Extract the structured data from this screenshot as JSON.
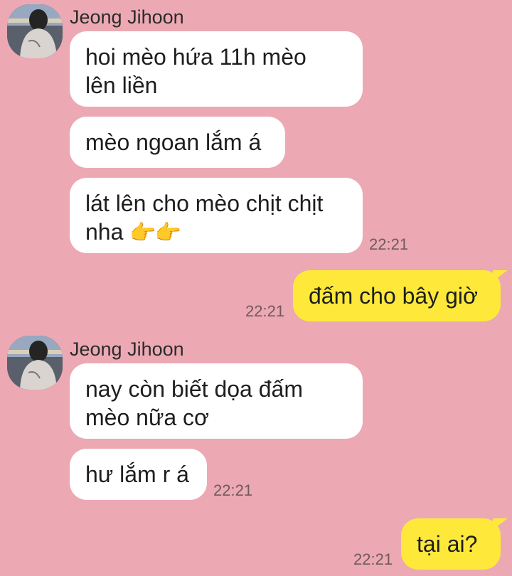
{
  "chat": {
    "groups": [
      {
        "sender": "Jeong Jihoon",
        "messages": [
          "hoi mèo hứa 11h mèo",
          "lên liền",
          "mèo ngoan lắm á",
          "lát lên cho mèo chịt chịt",
          "nha"
        ],
        "emoji": "👉👉",
        "time": "22:21"
      },
      {
        "sender": "Jeong Jihoon",
        "messages": [
          "nay còn biết dọa đấm",
          "mèo nữa cơ",
          "hư lắm r á"
        ],
        "time": "22:21"
      }
    ],
    "outgoing": [
      {
        "text": "đấm cho bây giờ",
        "time": "22:21"
      },
      {
        "text": "tại ai?",
        "time": "22:21"
      }
    ]
  },
  "colors": {
    "background": "#eca9b3",
    "incoming_bubble": "#ffffff",
    "outgoing_bubble": "#fee93b"
  },
  "icons": {
    "avatar": "avatar-photo"
  }
}
